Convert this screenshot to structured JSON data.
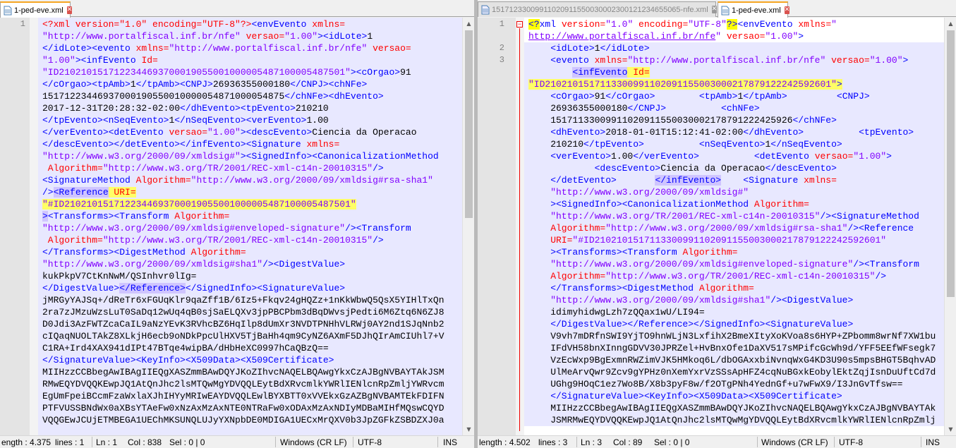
{
  "left": {
    "tabs": [
      {
        "label": "1-ped-eve.xml",
        "active": true
      }
    ],
    "lines": [
      [
        [
          "decl",
          "<?xml version=\"1.0\" encoding=\"UTF-8\"?>"
        ],
        [
          "tag",
          "<envEvento "
        ],
        [
          "attr",
          "xmlns="
        ]
      ],
      [
        [
          "val",
          "\"http://www.portalfiscal.inf.br/nfe\""
        ],
        [
          "attr",
          " versao="
        ],
        [
          "val",
          "\"1.00\""
        ],
        [
          "tag",
          "><idLote>"
        ],
        [
          "txt",
          "1"
        ]
      ],
      [
        [
          "tag",
          "</idLote><evento "
        ],
        [
          "attr",
          "xmlns="
        ],
        [
          "val",
          "\"http://www.portalfiscal.inf.br/nfe\""
        ],
        [
          "attr",
          " versao="
        ]
      ],
      [
        [
          "val",
          "\"1.00\""
        ],
        [
          "tag",
          "><infEvento "
        ],
        [
          "attr",
          "Id="
        ]
      ],
      [
        [
          "val",
          "\"ID2102101517122344693700019055001000005487100005487501\""
        ],
        [
          "tag",
          "><cOrgao>"
        ],
        [
          "txt",
          "91"
        ]
      ],
      [
        [
          "tag",
          "</cOrgao><tpAmb>"
        ],
        [
          "txt",
          "1"
        ],
        [
          "tag",
          "</tpAmb><CNPJ>"
        ],
        [
          "txt",
          "26936355000180"
        ],
        [
          "tag",
          "</CNPJ><chNFe>"
        ]
      ],
      [
        [
          "txt",
          "15171223446937000190550010000054871000054875"
        ],
        [
          "tag",
          "</chNFe><dhEvento>"
        ]
      ],
      [
        [
          "txt",
          "2017-12-31T20:28:32-02:00"
        ],
        [
          "tag",
          "</dhEvento><tpEvento>"
        ],
        [
          "txt",
          "210210"
        ]
      ],
      [
        [
          "tag",
          "</tpEvento><nSeqEvento>"
        ],
        [
          "txt",
          "1"
        ],
        [
          "tag",
          "</nSeqEvento><verEvento>"
        ],
        [
          "txt",
          "1.00"
        ]
      ],
      [
        [
          "tag",
          "</verEvento><detEvento "
        ],
        [
          "attr",
          "versao="
        ],
        [
          "val",
          "\"1.00\""
        ],
        [
          "tag",
          "><descEvento>"
        ],
        [
          "txt",
          "Ciencia da Operacao"
        ]
      ],
      [
        [
          "tag",
          "</descEvento></detEvento></infEvento><Signature "
        ],
        [
          "attr",
          "xmlns="
        ]
      ],
      [
        [
          "val",
          "\"http://www.w3.org/2000/09/xmldsig#\""
        ],
        [
          "tag",
          "><SignedInfo><CanonicalizationMethod"
        ]
      ],
      [
        [
          "attr",
          " Algorithm="
        ],
        [
          "val",
          "\"http://www.w3.org/TR/2001/REC-xml-c14n-20010315\""
        ],
        [
          "tag",
          "/>"
        ]
      ],
      [
        [
          "tag",
          "<SignatureMethod "
        ],
        [
          "attr",
          "Algorithm="
        ],
        [
          "val",
          "\"http://www.w3.org/2000/09/xmldsig#rsa-sha1\""
        ]
      ],
      [
        [
          "tag",
          "/>"
        ],
        [
          "tag hlp",
          "<Reference"
        ],
        [
          "attr match",
          " URI="
        ]
      ],
      [
        [
          "val match",
          "\"#ID2102101517122344693700019055001000005487100005487501\""
        ]
      ],
      [
        [
          "tag hlp",
          ">"
        ],
        [
          "tag",
          "<Transforms><Transform "
        ],
        [
          "attr",
          "Algorithm="
        ]
      ],
      [
        [
          "val",
          "\"http://www.w3.org/2000/09/xmldsig#enveloped-signature\""
        ],
        [
          "tag",
          "/><Transform"
        ]
      ],
      [
        [
          "attr",
          " Algorithm="
        ],
        [
          "val",
          "\"http://www.w3.org/TR/2001/REC-xml-c14n-20010315\""
        ],
        [
          "tag",
          "/>"
        ]
      ],
      [
        [
          "tag",
          "</Transforms><DigestMethod "
        ],
        [
          "attr",
          "Algorithm="
        ]
      ],
      [
        [
          "val",
          "\"http://www.w3.org/2000/09/xmldsig#sha1\""
        ],
        [
          "tag",
          "/><DigestValue>"
        ]
      ],
      [
        [
          "txt",
          "kukPkpV7CtKnNwM/QSInhvr0lIg="
        ]
      ],
      [
        [
          "tag",
          "</DigestValue>"
        ],
        [
          "tag hlp",
          "</Reference>"
        ],
        [
          "tag",
          "</SignedInfo><SignatureValue>"
        ]
      ],
      [
        [
          "txt",
          "jMRGyYAJSq+/dReTr6xFGUqKlr9qaZff1B/6Iz5+Fkqv24gHQZz+1nKkWbwQ5QsX5YIHlTxQn"
        ]
      ],
      [
        [
          "txt",
          "2ra7zJMzuWzsLuT0SaDq12wUq4qB0sjSaELQXv3jpPBCPbm3dBqDWvsjPedti6M6Ztq6N6ZJ8"
        ]
      ],
      [
        [
          "txt",
          "D0Jdi3AzFWTZcaCaIL9aNzYEvK3RVhcBZ6HqIlp8dUmXr3NVDTPNHhVLRWj0AY2nd1SJqNnb2"
        ]
      ],
      [
        [
          "txt",
          "cIQaqNUOLTAkZ8XLkjH6ecb9oNDkPpcUlHXV5TjBaHh4qm9CyNZ6AXmF5DJhQIrAmCIUhl7+V"
        ]
      ],
      [
        [
          "txt",
          "C1RA+Ird4XAX941dIPt47BTqe4wipBA/dHbHeXC0997hCaQBzQ=="
        ]
      ],
      [
        [
          "tag",
          "</SignatureValue><KeyInfo><X509Data><X509Certificate>"
        ]
      ],
      [
        [
          "txt",
          "MIIHzzCCBbegAwIBAgIIEQgXASZmmBAwDQYJKoZIhvcNAQELBQAwgYkxCzAJBgNVBAYTAkJSM"
        ]
      ],
      [
        [
          "txt",
          "RMwEQYDVQQKEwpJQ1AtQnJhc2lsMTQwMgYDVQQLEytBdXRvcmlkYWRlIENlcnRpZmljYWRvcm"
        ]
      ],
      [
        [
          "txt",
          "EgUmFpeiBCcmFzaWxlaXJhIHYyMRIwEAYDVQQLEwlBYXBTT0xVVEkxGzAZBgNVBAMTEkFDIFN"
        ]
      ],
      [
        [
          "txt",
          "PTFVUSSBNdWx0aXBsYTAeFw0xNzAxMzAxNTE0NTRaFw0xODAxMzAxNDIyMDBaMIHfMQswCQYD"
        ]
      ],
      [
        [
          "txt",
          "VQQGEwJCUjETMBEGA1UEChMKSUNQLUJyYXNpbDE0MDIGA1UECxMrQXV0b3JpZGFkZSBDZXJ0a"
        ]
      ]
    ],
    "line_numbers": [
      "1"
    ],
    "status": {
      "length": "ength : 4.375",
      "lines": "lines : 1",
      "ln": "Ln : 1",
      "col": "Col : 838",
      "sel": "Sel : 0 | 0",
      "eol": "Windows (CR LF)",
      "encoding": "UTF-8",
      "mode": "INS"
    }
  },
  "right": {
    "tabs": [
      {
        "label": "15171233009911020911550030002300121234655065-nfe.xml",
        "active": false
      },
      {
        "label": "1-ped-eve.xml",
        "active": true
      }
    ],
    "lines": [
      [
        [
          "qmark",
          "<?"
        ],
        [
          "tag",
          "xml"
        ],
        [
          "attr",
          " version="
        ],
        [
          "val",
          "\"1.0\""
        ],
        [
          "attr",
          " encoding="
        ],
        [
          "val",
          "\"UTF-8\""
        ],
        [
          "qmark",
          "?>"
        ],
        [
          "tag",
          "<envEvento "
        ],
        [
          "attr",
          "xmlns="
        ],
        [
          "val",
          "\""
        ]
      ],
      [
        [
          "val under",
          "http://www.portalfiscal.inf.br/nfe"
        ],
        [
          "val",
          "\""
        ],
        [
          "attr",
          " versao="
        ],
        [
          "val",
          "\"1.00\""
        ],
        [
          "tag",
          ">"
        ]
      ],
      [
        [
          "tag",
          "    <idLote>"
        ],
        [
          "txt",
          "1"
        ],
        [
          "tag",
          "</idLote>"
        ]
      ],
      [
        [
          "tag",
          "    <evento "
        ],
        [
          "attr",
          "xmlns="
        ],
        [
          "val",
          "\"http://www.portalfiscal.inf.br/nfe\""
        ],
        [
          "attr",
          " versao="
        ],
        [
          "val",
          "\"1.00\""
        ],
        [
          "tag",
          ">"
        ]
      ],
      [
        [
          "tag",
          "        "
        ],
        [
          "tag hlp",
          "<infEvento"
        ],
        [
          "attr match",
          " Id="
        ]
      ],
      [
        [
          "val match",
          "\"ID2102101517113300991102091155003000217879122242592601\""
        ],
        [
          "tag match",
          ">"
        ]
      ],
      [
        [
          "tag",
          "    <cOrgao>"
        ],
        [
          "txt",
          "91"
        ],
        [
          "tag",
          "</cOrgao>        <tpAmb>"
        ],
        [
          "txt",
          "1"
        ],
        [
          "tag",
          "</tpAmb>         <CNPJ>"
        ]
      ],
      [
        [
          "txt",
          "    26936355000180"
        ],
        [
          "tag",
          "</CNPJ>          <chNFe>"
        ]
      ],
      [
        [
          "txt",
          "    15171133009911020911550030002178791222425926"
        ],
        [
          "tag",
          "</chNFe>"
        ]
      ],
      [
        [
          "tag",
          "    <dhEvento>"
        ],
        [
          "txt",
          "2018-01-01T15:12:41-02:00"
        ],
        [
          "tag",
          "</dhEvento>          <tpEvento>"
        ]
      ],
      [
        [
          "txt",
          "    210210"
        ],
        [
          "tag",
          "</tpEvento>          <nSeqEvento>"
        ],
        [
          "txt",
          "1"
        ],
        [
          "tag",
          "</nSeqEvento>"
        ]
      ],
      [
        [
          "tag",
          "    <verEvento>"
        ],
        [
          "txt",
          "1.00"
        ],
        [
          "tag",
          "</verEvento>          <detEvento "
        ],
        [
          "attr",
          "versao="
        ],
        [
          "val",
          "\"1.00\""
        ],
        [
          "tag",
          ">"
        ]
      ],
      [
        [
          "tag",
          "            <descEvento>"
        ],
        [
          "txt",
          "Ciencia da Operacao"
        ],
        [
          "tag",
          "</descEvento>"
        ]
      ],
      [
        [
          "tag",
          "    </detEvento>       "
        ],
        [
          "tag hlp",
          "</infEvento>"
        ],
        [
          "tag",
          "    <Signature "
        ],
        [
          "attr",
          "xmlns="
        ]
      ],
      [
        [
          "val",
          "    \"http://www.w3.org/2000/09/xmldsig#\""
        ]
      ],
      [
        [
          "tag",
          "    ><SignedInfo><CanonicalizationMethod "
        ],
        [
          "attr",
          "Algorithm="
        ]
      ],
      [
        [
          "val",
          "    \"http://www.w3.org/TR/2001/REC-xml-c14n-20010315\""
        ],
        [
          "tag",
          "/><SignatureMethod"
        ]
      ],
      [
        [
          "attr",
          "    Algorithm="
        ],
        [
          "val",
          "\"http://www.w3.org/2000/09/xmldsig#rsa-sha1\""
        ],
        [
          "tag",
          "/><Reference"
        ]
      ],
      [
        [
          "attr",
          "    URI="
        ],
        [
          "val",
          "\"#ID2102101517113300991102091155003000217879122242592601\""
        ]
      ],
      [
        [
          "tag",
          "    ><Transforms><Transform "
        ],
        [
          "attr",
          "Algorithm="
        ]
      ],
      [
        [
          "val",
          "    \"http://www.w3.org/2000/09/xmldsig#enveloped-signature\""
        ],
        [
          "tag",
          "/><Transform"
        ]
      ],
      [
        [
          "attr",
          "    Algorithm="
        ],
        [
          "val",
          "\"http://www.w3.org/TR/2001/REC-xml-c14n-20010315\""
        ],
        [
          "tag",
          "/>"
        ]
      ],
      [
        [
          "tag",
          "    </Transforms><DigestMethod "
        ],
        [
          "attr",
          "Algorithm="
        ]
      ],
      [
        [
          "val",
          "    \"http://www.w3.org/2000/09/xmldsig#sha1\""
        ],
        [
          "tag",
          "/><DigestValue>"
        ]
      ],
      [
        [
          "txt",
          "    idimyhidwgLzh7zQQax1wU/LI94="
        ]
      ],
      [
        [
          "tag",
          "    </DigestValue></Reference></SignedInfo><SignatureValue>"
        ]
      ],
      [
        [
          "txt",
          "    V9vh7mDRfnSWI9YjTO9hnWLjN3LxfihX2BmeXItyXoKVoa8s6HYP+ZPbomm8wrNf7XW1bu"
        ]
      ],
      [
        [
          "txt",
          "    IFdVH58bnXInngGDVV30JPRZel+HvBnxOfe1DaXV517sMPifcGcWh9d/YFF5EEfWFsegk7"
        ]
      ],
      [
        [
          "txt",
          "    VzEcWxp9BgExmnRWZimVJK5HMkoq6L/dbOGAxxbiNvnqWxG4KD3U90s5mpsBHGT5BqhvAD"
        ]
      ],
      [
        [
          "txt",
          "    UlMeArvQwr9Zcv9gYPHz0nXemYxrVzSSsApHFZ4cqNuBGxkEobylEktZqjIsnDuUftCd7d"
        ]
      ],
      [
        [
          "txt",
          "    UGhg9HOqC1ez7Wo8B/X8b3pyF8w/f2OTgPNh4YednGf+u7wFwX9/I3JnGvTfsw=="
        ]
      ],
      [
        [
          "tag",
          "    </SignatureValue><KeyInfo><X509Data><X509Certificate>"
        ]
      ],
      [
        [
          "txt",
          "    MIIHzzCCBbegAwIBAgIIEQgXASZmmBAwDQYJKoZIhvcNAQELBQAwgYkxCzAJBgNVBAYTAk"
        ]
      ],
      [
        [
          "txt",
          "    JSMRMwEQYDVQQKEwpJQ1AtQnJhc2lsMTQwMgYDVQQLEytBdXRvcmlkYWRlIENlcnRpZmlj"
        ]
      ]
    ],
    "line_numbers": [
      "1",
      "2",
      "3"
    ],
    "status": {
      "length": "length : 4.502",
      "lines": "lines : 3",
      "ln": "Ln : 3",
      "col": "Col : 89",
      "sel": "Sel : 0 | 0",
      "eol": "Windows (CR LF)",
      "encoding": "UTF-8",
      "mode": "INS"
    }
  },
  "icons": {
    "tab_close": "close-icon",
    "doc": "document-icon",
    "fold": "fold-minus-icon",
    "scroll_up": "arrow-up-icon",
    "scroll_down": "arrow-down-icon"
  },
  "colors": {
    "tag": "#0000ff",
    "attr": "#ff0000",
    "value": "#8000ff",
    "selection": "#e8e8ff",
    "tab_accent": "#f5a623"
  }
}
